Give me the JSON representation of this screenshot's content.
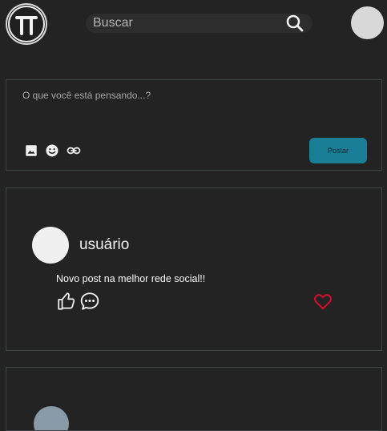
{
  "header": {
    "search": {
      "placeholder": "Buscar"
    },
    "icons": {
      "logo": "logo-icon",
      "search": "search-icon",
      "avatar": "avatar"
    }
  },
  "composer": {
    "placeholder": "O que você está pensando...?",
    "tools": [
      "image-icon",
      "emoji-icon",
      "link-icon"
    ],
    "post_label": "Postar"
  },
  "post": {
    "username": "usuário",
    "text": "Novo post na melhor rede social!!",
    "actions": [
      "like-icon",
      "comment-icon",
      "heart-icon"
    ]
  },
  "colors": {
    "background": "#232323",
    "accent": "#1a7e96",
    "heart": "#c8102e"
  }
}
